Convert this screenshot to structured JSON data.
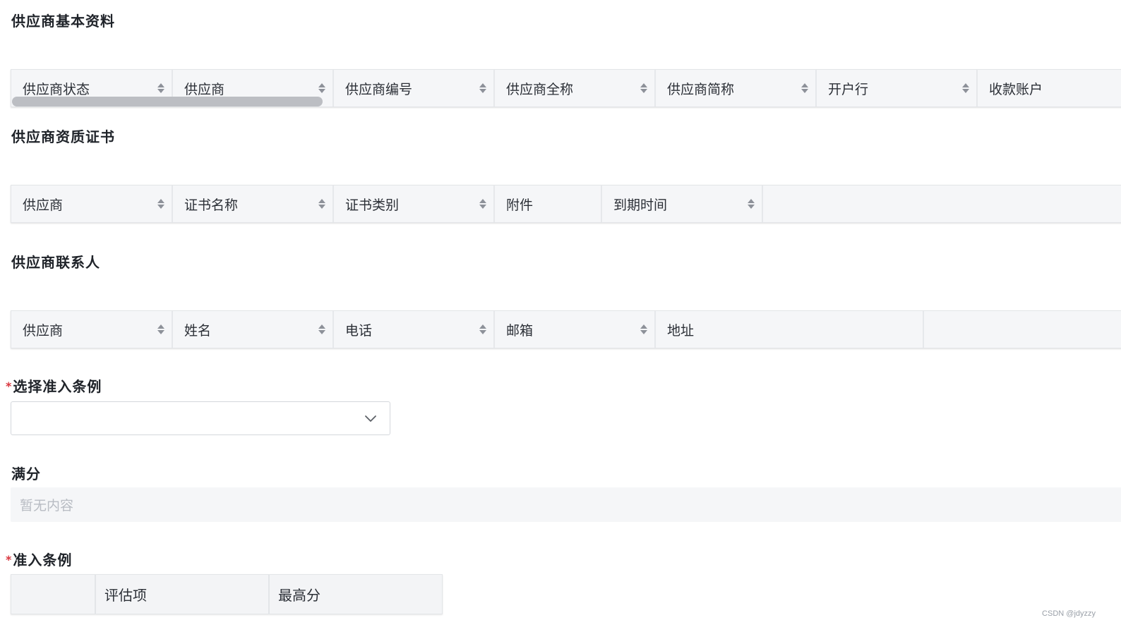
{
  "sections": {
    "basic_info": {
      "title": "供应商基本资料",
      "columns": [
        {
          "label": "供应商状态",
          "sortable": true
        },
        {
          "label": "供应商",
          "sortable": true
        },
        {
          "label": "供应商编号",
          "sortable": true
        },
        {
          "label": "供应商全称",
          "sortable": true
        },
        {
          "label": "供应商简称",
          "sortable": true
        },
        {
          "label": "开户行",
          "sortable": true
        },
        {
          "label": "收款账户",
          "sortable": false
        }
      ]
    },
    "certificates": {
      "title": "供应商资质证书",
      "columns": [
        {
          "label": "供应商",
          "sortable": true
        },
        {
          "label": "证书名称",
          "sortable": true
        },
        {
          "label": "证书类别",
          "sortable": true
        },
        {
          "label": "附件",
          "sortable": false
        },
        {
          "label": "到期时间",
          "sortable": true
        }
      ]
    },
    "contacts": {
      "title": "供应商联系人",
      "columns": [
        {
          "label": "供应商",
          "sortable": true
        },
        {
          "label": "姓名",
          "sortable": true
        },
        {
          "label": "电话",
          "sortable": true
        },
        {
          "label": "邮箱",
          "sortable": true
        },
        {
          "label": "地址",
          "sortable": false
        }
      ]
    }
  },
  "admission_select": {
    "required_mark": "*",
    "label": "选择准入条例",
    "value": ""
  },
  "full_score": {
    "label": "满分",
    "empty_text": "暂无内容"
  },
  "criteria": {
    "required_mark": "*",
    "label": "准入条例",
    "columns": [
      "",
      "评估项",
      "最高分"
    ]
  },
  "watermark": "CSDN @jdyzzy",
  "colors": {
    "required": "#d9363e",
    "header_bg": "#f5f6f8",
    "placeholder": "#b8bcc3"
  }
}
